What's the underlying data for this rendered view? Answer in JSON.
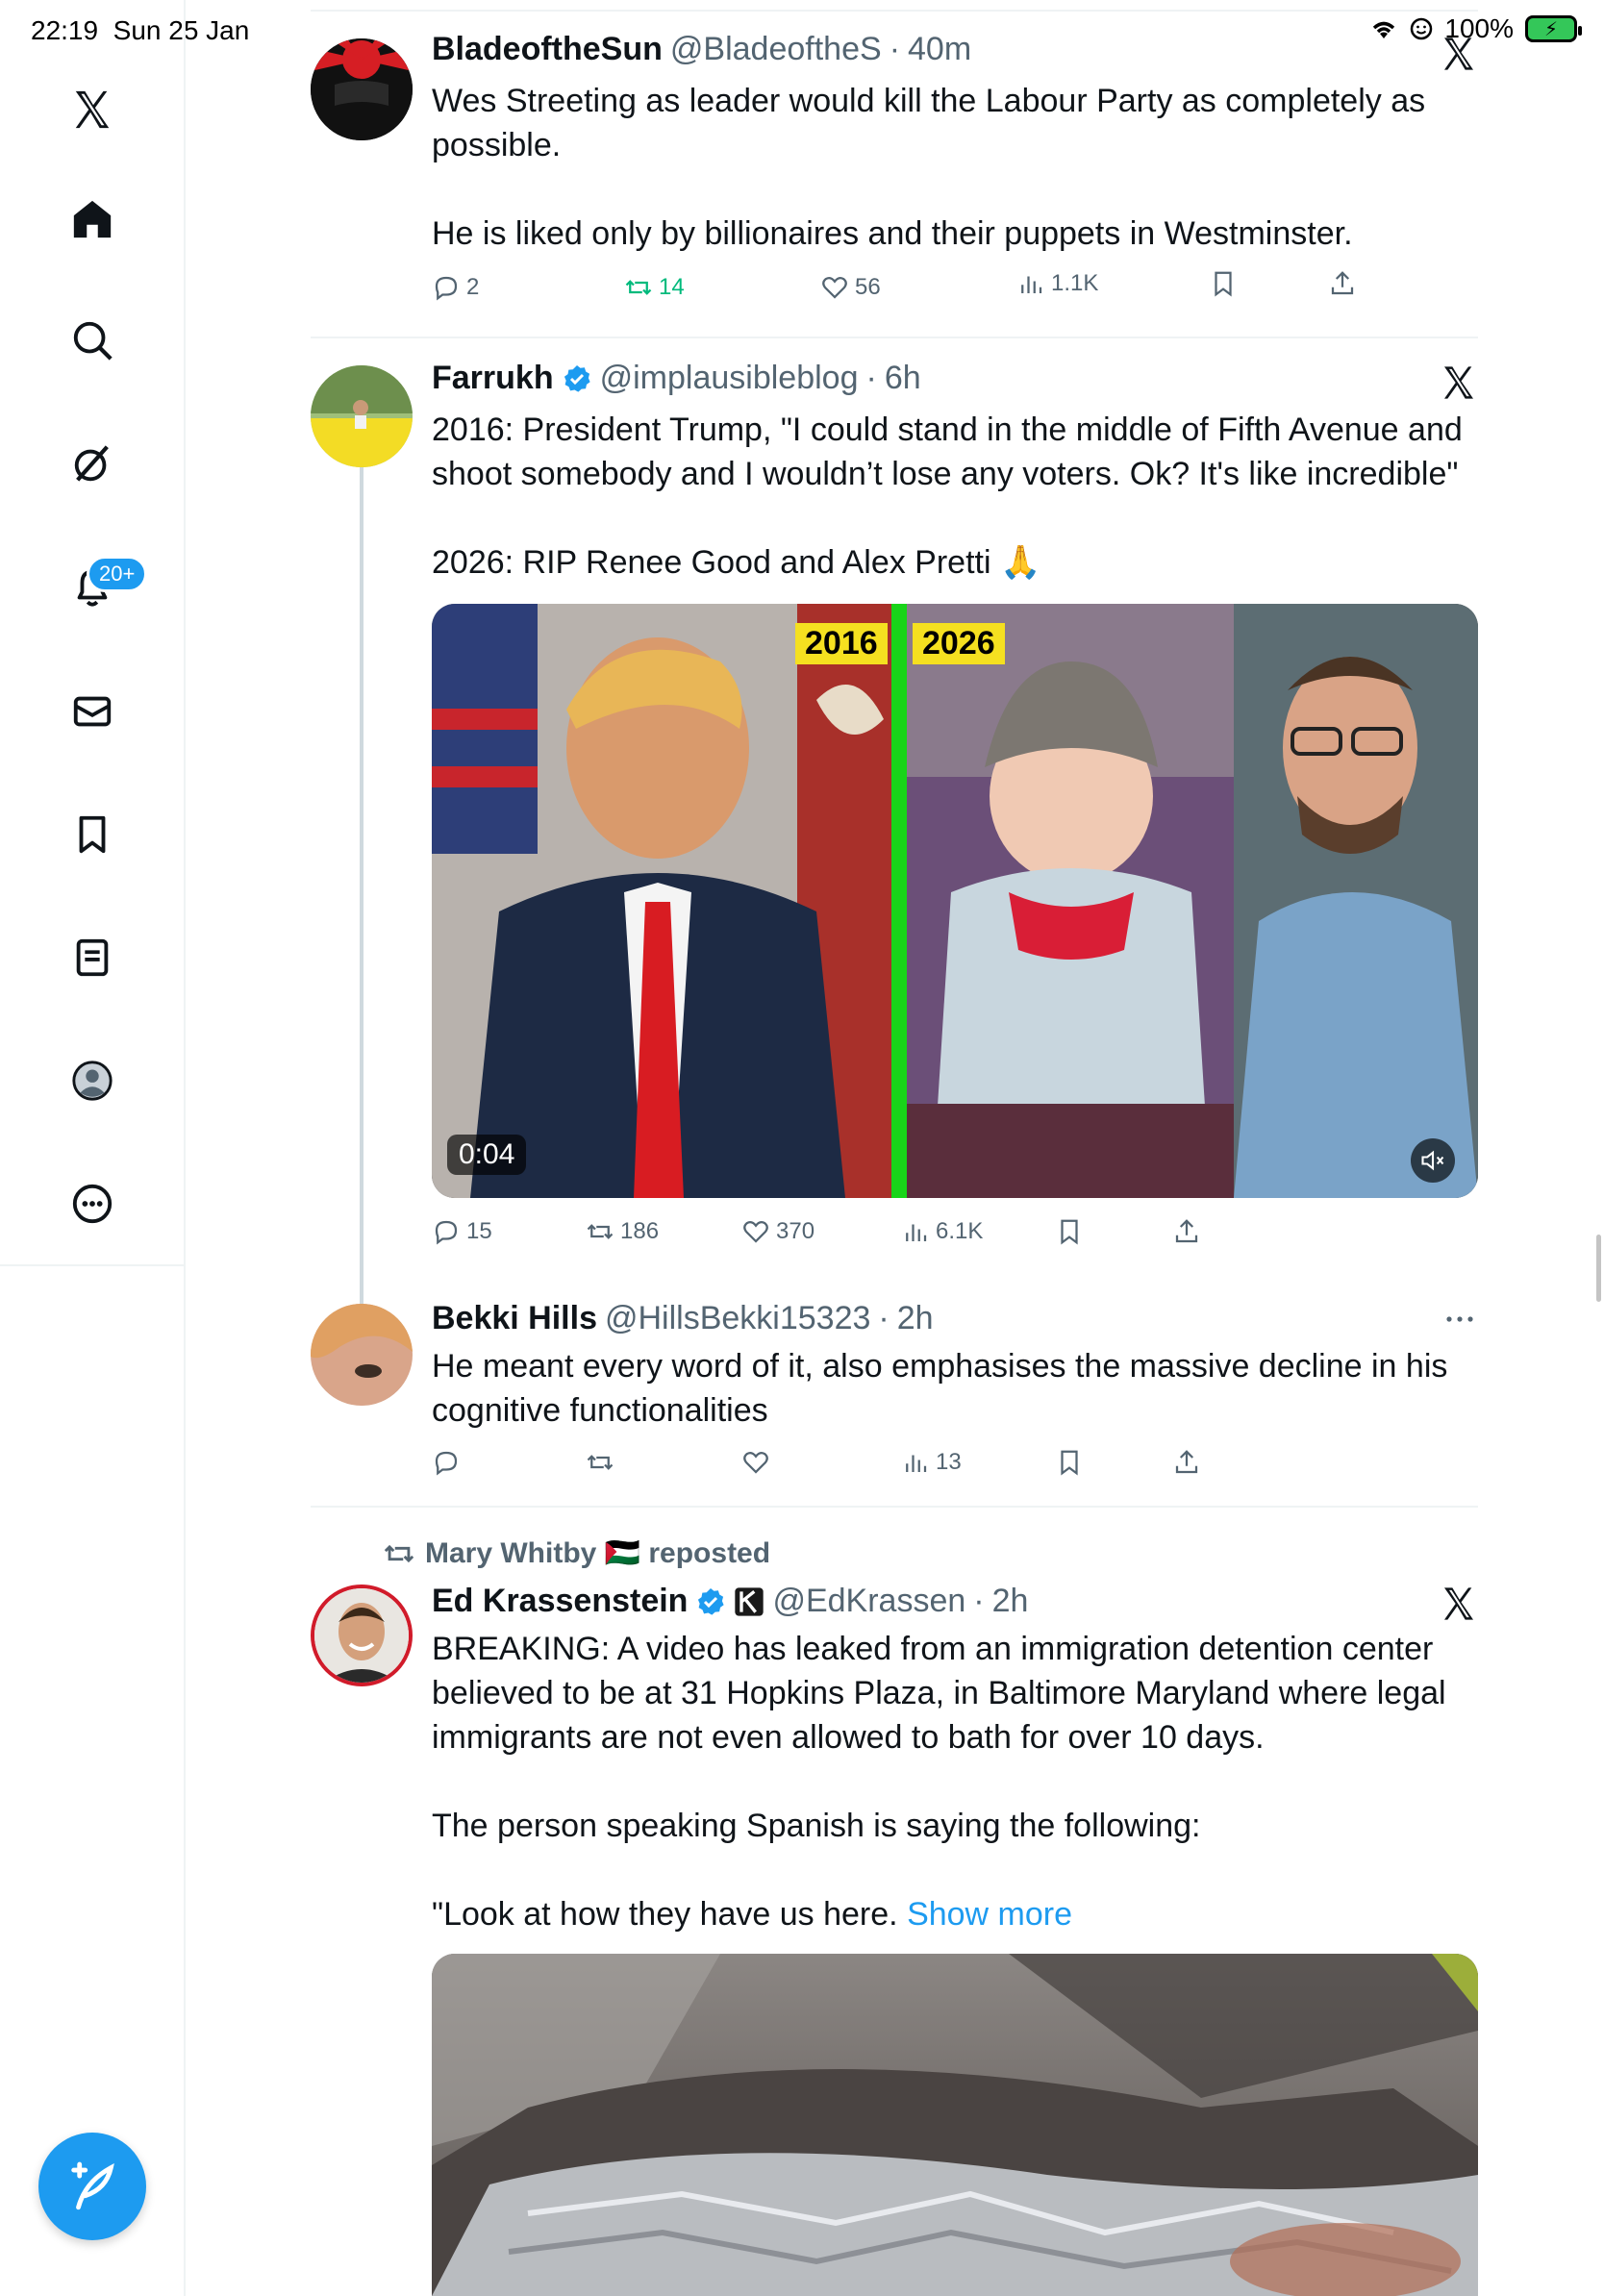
{
  "status_bar": {
    "time": "22:19",
    "date": "Sun 25 Jan",
    "battery": "100%"
  },
  "sidebar": {
    "notifications_badge": "20+",
    "icons": [
      "x-logo-icon",
      "home-icon",
      "search-icon",
      "grok-icon",
      "bell-icon",
      "mail-icon",
      "bookmark-icon",
      "lists-icon",
      "profile-icon",
      "more-icon"
    ],
    "compose_icon": "feather-plus-icon"
  },
  "tweets": [
    {
      "name": "BladeoftheSun",
      "handle": "@BladeoftheS",
      "time": "40m",
      "paragraphs": [
        "Wes Streeting as leader would kill the Labour Party as completely as possible.",
        "He is liked only by billionaires and their puppets in Westminster."
      ],
      "replies": "2",
      "reposts": "14",
      "likes": "56",
      "views": "1.1K",
      "accent": "#00ba7c"
    },
    {
      "name": "Farrukh",
      "handle": "@implausibleblog",
      "time": "6h",
      "paragraphs": [
        "2016: President Trump, \"I could stand in the middle of Fifth Avenue and shoot somebody and I wouldn’t lose any voters. Ok? It's like incredible\"",
        "2026: RIP Renee Good and Alex Pretti 🙏"
      ],
      "media": {
        "label_left": "2016",
        "label_right": "2026",
        "duration": "0:04"
      },
      "replies": "15",
      "reposts": "186",
      "likes": "370",
      "views": "6.1K"
    },
    {
      "name": "Bekki Hills",
      "handle": "@HillsBekki15323",
      "time": "2h",
      "paragraphs": [
        "He meant every word of it, also emphasises the massive decline in his cognitive functionalities"
      ],
      "replies": "",
      "reposts": "",
      "likes": "",
      "views": "13"
    },
    {
      "repost_by": "Mary Whitby 🇵🇸 reposted",
      "name": "Ed Krassenstein",
      "handle": "@EdKrassen",
      "time": "2h",
      "paragraphs": [
        "BREAKING: A video has leaked from an immigration detention center believed to be at 31 Hopkins Plaza, in Baltimore Maryland where legal immigrants are not even allowed to bath for over 10 days.",
        "The person speaking Spanish is saying the following:",
        "\"Look at how they have us here."
      ],
      "show_more": "Show more"
    }
  ],
  "separator": "·"
}
